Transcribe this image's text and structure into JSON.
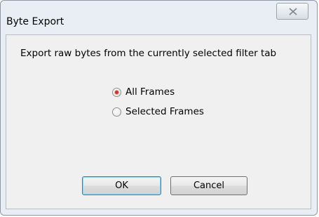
{
  "dialog": {
    "title": "Byte Export",
    "description": "Export raw bytes from the currently selected filter tab",
    "options": [
      {
        "label": "All Frames",
        "selected": true
      },
      {
        "label": "Selected Frames",
        "selected": false
      }
    ],
    "ok_label": "OK",
    "cancel_label": "Cancel"
  },
  "colors": {
    "window_frame": "#e9eef5",
    "client_background": "#f0f0f0",
    "radio_selected": "#c0392b"
  }
}
